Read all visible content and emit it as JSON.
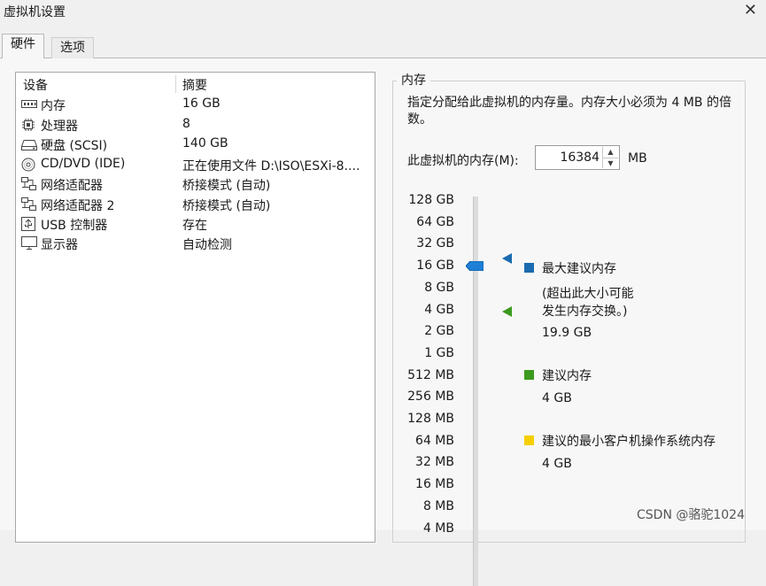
{
  "window": {
    "title": "虚拟机设置",
    "close_glyph": "✕"
  },
  "tabs": [
    {
      "label": "硬件",
      "active": true
    },
    {
      "label": "选项",
      "active": false
    }
  ],
  "devices": {
    "header": {
      "device": "设备",
      "summary": "摘要"
    },
    "items": [
      {
        "icon": "memory-icon",
        "name": "内存",
        "summary": "16 GB"
      },
      {
        "icon": "processor-icon",
        "name": "处理器",
        "summary": "8"
      },
      {
        "icon": "harddisk-icon",
        "name": "硬盘 (SCSI)",
        "summary": "140 GB"
      },
      {
        "icon": "cd-dvd-icon",
        "name": "CD/DVD (IDE)",
        "summary": "正在使用文件 D:\\ISO\\ESXi-8...."
      },
      {
        "icon": "network-adapter-icon",
        "name": "网络适配器",
        "summary": "桥接模式 (自动)"
      },
      {
        "icon": "network-adapter-icon",
        "name": "网络适配器 2",
        "summary": "桥接模式 (自动)"
      },
      {
        "icon": "usb-icon",
        "name": "USB 控制器",
        "summary": "存在"
      },
      {
        "icon": "display-icon",
        "name": "显示器",
        "summary": "自动检测"
      }
    ]
  },
  "memory": {
    "group_title": "内存",
    "description": "指定分配给此虚拟机的内存量。内存大小必须为 4 MB 的倍数。",
    "field_label": "此虚拟机的内存(M):",
    "value": "16384",
    "unit": "MB",
    "scale_labels": [
      "128 GB",
      "64 GB",
      "32 GB",
      "16 GB",
      "8 GB",
      "4 GB",
      "2 GB",
      "1 GB",
      "512 MB",
      "256 MB",
      "128 MB",
      "64 MB",
      "32 MB",
      "16 MB",
      "8 MB",
      "4 MB"
    ],
    "slider_current": "16 GB",
    "legend": {
      "max": {
        "label": "最大建议内存",
        "note": "(超出此大小可能发生内存交换。)",
        "note_line1": "(超出此大小可能",
        "note_line2": "发生内存交换。)",
        "value": "19.9 GB",
        "color": "#1a6bb0"
      },
      "recommended": {
        "label": "建议内存",
        "value": "4 GB",
        "color": "#3c9a1f"
      },
      "min_guest": {
        "label": "建议的最小客户机操作系统内存",
        "value": "4 GB",
        "color": "#f5cf00"
      }
    }
  },
  "watermark": "CSDN @骆驼1024"
}
